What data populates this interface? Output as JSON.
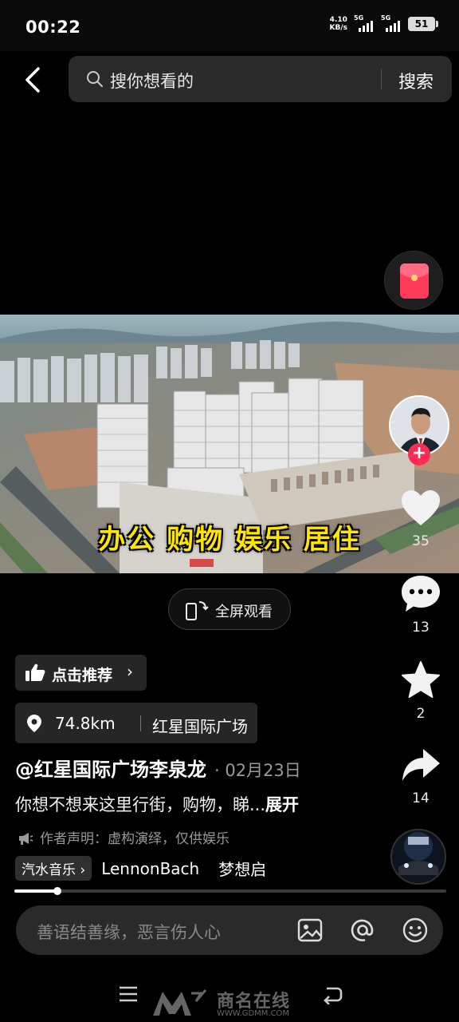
{
  "status_bar": {
    "time": "00:22",
    "net_speed_value": "4.10",
    "net_speed_unit": "KB/s",
    "signal_1": "5G",
    "signal_2": "5G",
    "battery": "51"
  },
  "search": {
    "placeholder": "搜你想看的",
    "button_label": "搜索"
  },
  "video": {
    "caption": "办公 购物 娱乐 居住"
  },
  "fullscreen": {
    "label": "全屏观看"
  },
  "actions": {
    "likes": "35",
    "comments": "13",
    "favorites": "2",
    "shares": "14"
  },
  "post": {
    "recommend_label": "点击推荐",
    "distance": "74.8km",
    "location": "红星国际广场",
    "author": "@红星国际广场李泉龙",
    "date": "· 02月23日",
    "description": "你想不想来这里行街，购物，睇...",
    "expand_label": "展开",
    "disclaimer": "作者声明：虚构演绎，仅供娱乐",
    "music_tag": "汽水音乐",
    "music_artist": "LennonBach",
    "music_title": "梦想启",
    "progress": 0.1
  },
  "comment": {
    "placeholder": "善语结善缘，恶言伤人心"
  },
  "watermark": {
    "text": "商名在线",
    "url": "WWW.GDMM.COM"
  },
  "colors": {
    "accent_red": "#fe2c55",
    "caption_yellow": "#ffe600",
    "background": "#000000"
  }
}
